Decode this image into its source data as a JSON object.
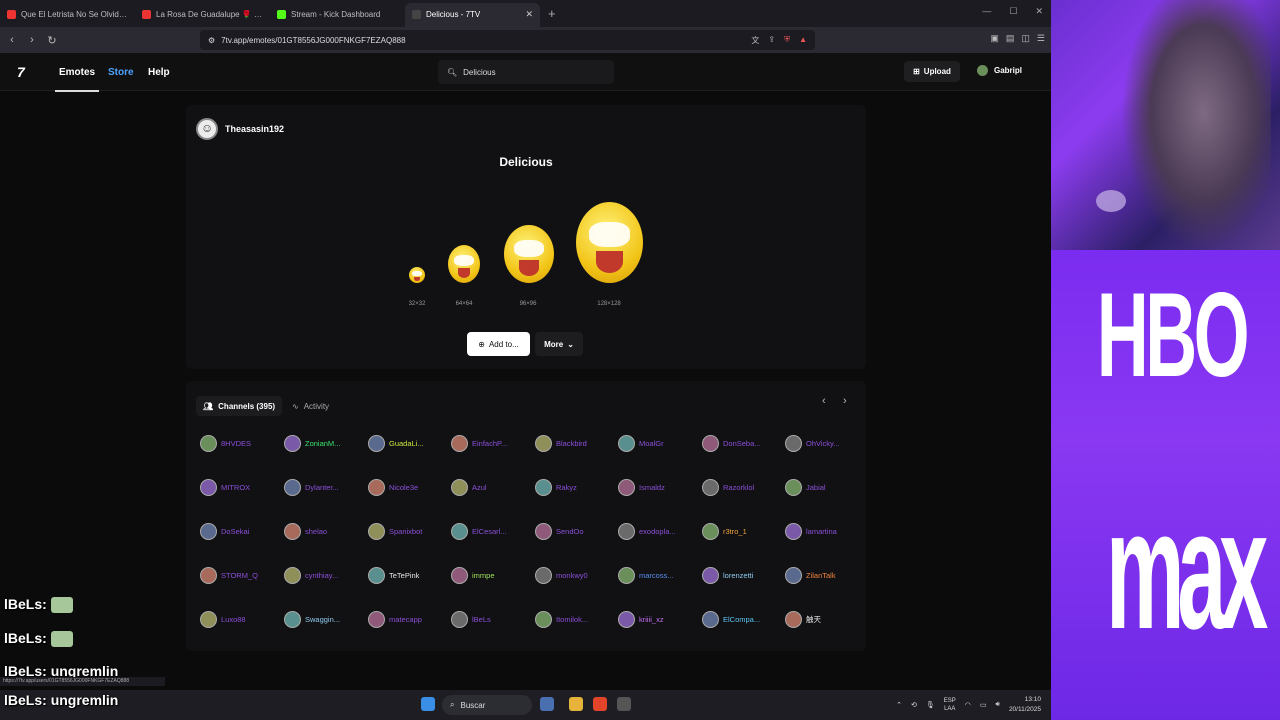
{
  "browser": {
    "tabs": [
      {
        "title": "Que El Letrista No Se Olvide - YouTube",
        "color": "#e33"
      },
      {
        "title": "La Rosa De Guadalupe 🌹 Viral [Par",
        "color": "#e33"
      },
      {
        "title": "Stream - Kick Dashboard",
        "color": "#53fc18"
      },
      {
        "title": "Delicious - 7TV",
        "color": "#2b2a33",
        "active": true
      }
    ],
    "url": "7tv.app/emotes/01GT8556JG000FNKGF7EZAQ888"
  },
  "site": {
    "logo": "7",
    "nav": {
      "emotes": "Emotes",
      "store": "Store",
      "help": "Help"
    },
    "search": "Delicious",
    "upload": "Upload",
    "user": "Gabripl"
  },
  "emote": {
    "owner": "Theasasin192",
    "title": "Delicious",
    "sizes": [
      "32×32",
      "64×64",
      "96×96",
      "128×128"
    ],
    "add_label": "Add to...",
    "more_label": "More"
  },
  "channels": {
    "tab_channels": "Channels (395)",
    "tab_activity": "Activity",
    "rows": [
      [
        {
          "n": "8HVDES",
          "c": "#8a4fd8"
        },
        {
          "n": "ZonianM...",
          "c": "#3be36d"
        },
        {
          "n": "GuadaLi...",
          "c": "#c9e83c"
        },
        {
          "n": "EinfachP...",
          "c": "#8a4fd8"
        },
        {
          "n": "Blackbird",
          "c": "#8a4fd8"
        },
        {
          "n": "MoalGr",
          "c": "#8a4fd8"
        },
        {
          "n": "DonSeba...",
          "c": "#8a4fd8"
        },
        {
          "n": "OhVicky...",
          "c": "#8a4fd8"
        }
      ],
      [
        {
          "n": "MITROX",
          "c": "#8a4fd8"
        },
        {
          "n": "Dylanter...",
          "c": "#8a4fd8"
        },
        {
          "n": "Nicole3e",
          "c": "#8a4fd8"
        },
        {
          "n": "Azul",
          "c": "#8a4fd8"
        },
        {
          "n": "Rakyz",
          "c": "#8a4fd8"
        },
        {
          "n": "Ismaldz",
          "c": "#8a4fd8"
        },
        {
          "n": "Razorklol",
          "c": "#8a4fd8"
        },
        {
          "n": "Jabial",
          "c": "#8a4fd8"
        }
      ],
      [
        {
          "n": "DoSekai",
          "c": "#8a4fd8"
        },
        {
          "n": "shelao",
          "c": "#8a4fd8"
        },
        {
          "n": "Spanixbot",
          "c": "#8a4fd8"
        },
        {
          "n": "ElCesarl...",
          "c": "#8a4fd8"
        },
        {
          "n": "SendOo",
          "c": "#8a4fd8"
        },
        {
          "n": "exodopla...",
          "c": "#8a4fd8"
        },
        {
          "n": "r3tro_1",
          "c": "#f0a43c"
        },
        {
          "n": "lamartina",
          "c": "#8a4fd8"
        }
      ],
      [
        {
          "n": "STORM_Q",
          "c": "#8a4fd8"
        },
        {
          "n": "cynthiay...",
          "c": "#8a4fd8"
        },
        {
          "n": "TeTePink",
          "c": "#e8e8e8"
        },
        {
          "n": "immpe",
          "c": "#9fe25a"
        },
        {
          "n": "monkwy0",
          "c": "#8a4fd8"
        },
        {
          "n": "marcoss...",
          "c": "#5b8ef0"
        },
        {
          "n": "lorenzetti",
          "c": "#8ecbf0"
        },
        {
          "n": "ZilanTalk",
          "c": "#f0843c"
        }
      ],
      [
        {
          "n": "Luxo88",
          "c": "#8a4fd8"
        },
        {
          "n": "Swaggin...",
          "c": "#8ecbf0"
        },
        {
          "n": "matecapp",
          "c": "#8a4fd8"
        },
        {
          "n": "lBeLs",
          "c": "#8a4fd8"
        },
        {
          "n": "Itomilok...",
          "c": "#8a4fd8"
        },
        {
          "n": "kriiii_xz",
          "c": "#c56ef0"
        },
        {
          "n": "ElCompa...",
          "c": "#5bc6f0"
        },
        {
          "n": "触天",
          "c": "#e8e8e8"
        }
      ]
    ]
  },
  "chat": [
    {
      "user": "lBeLs:",
      "msg": ""
    },
    {
      "user": "lBeLs:",
      "msg": ""
    },
    {
      "user": "lBeLs:",
      "msg": "ungremlin"
    },
    {
      "user": "lBeLs:",
      "msg": "ungremlin"
    }
  ],
  "status_url": "https://7tv.app/users/01GT8556JG000FNKGF7EZAQ888",
  "taskbar": {
    "search": "Buscar",
    "lang1": "ESP",
    "lang2": "LAA",
    "time": "13:10",
    "date": "20/11/2025"
  },
  "overlay": {
    "line1": "HBO",
    "line2": "max"
  },
  "colors": {
    "accent": "#4ea3ff",
    "hbo_purple": "#7a2cf0"
  }
}
